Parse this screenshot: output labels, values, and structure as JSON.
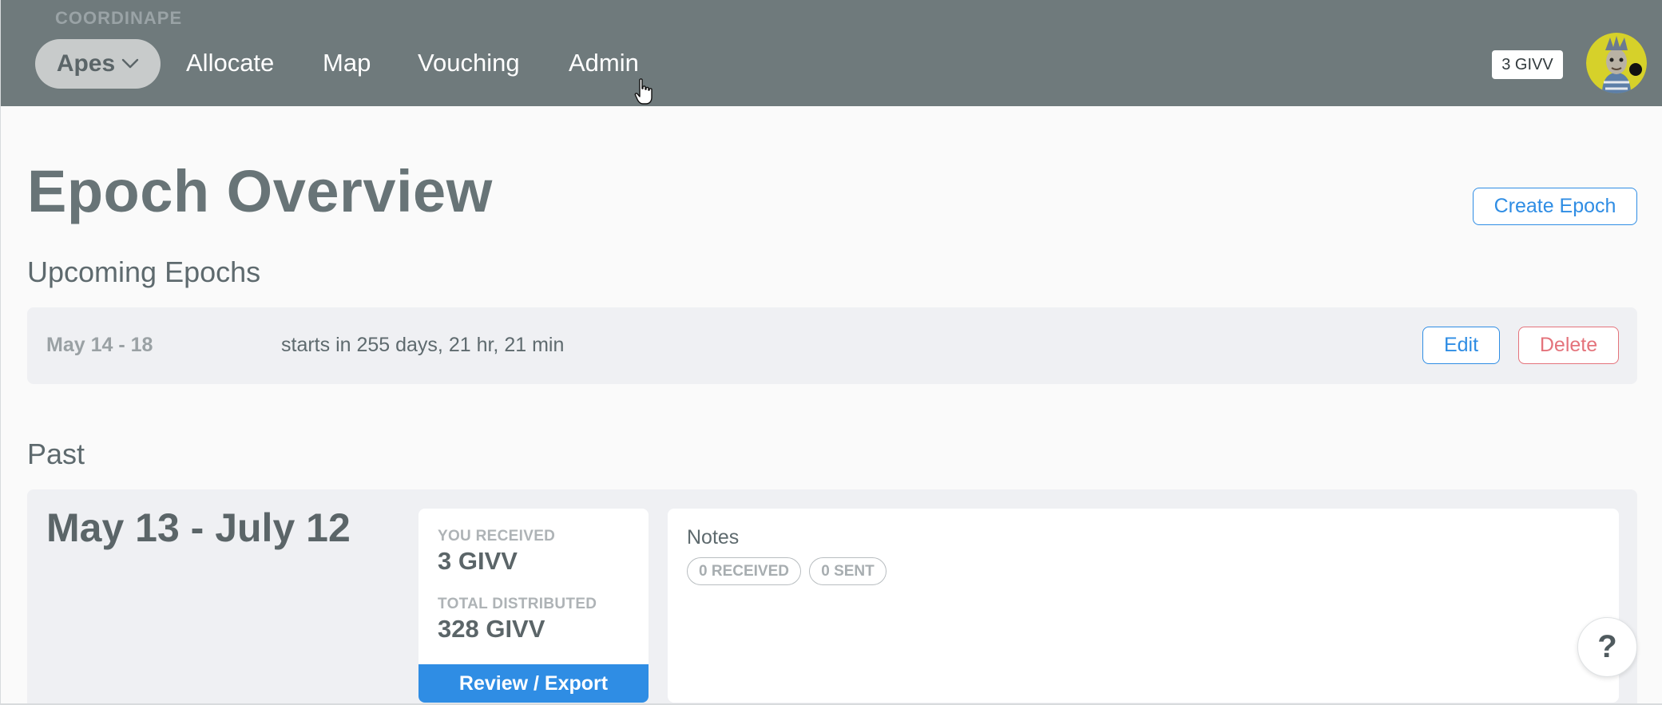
{
  "app": {
    "brand": "COORDINAPE"
  },
  "nav": {
    "circle_selector": "Apes",
    "links": [
      "Allocate",
      "Map",
      "Vouching",
      "Admin"
    ],
    "givv_badge": "3 GIVV"
  },
  "page": {
    "title": "Epoch Overview",
    "create_button": "Create Epoch"
  },
  "upcoming": {
    "heading": "Upcoming Epochs",
    "items": [
      {
        "dates": "May 14 - 18",
        "starts": "starts in 255 days, 21 hr, 21 min",
        "edit_label": "Edit",
        "delete_label": "Delete"
      }
    ]
  },
  "past": {
    "heading": "Past",
    "items": [
      {
        "dates": "May 13 - July 12",
        "received_label": "YOU RECEIVED",
        "received_value": "3 GIVV",
        "distributed_label": "TOTAL DISTRIBUTED",
        "distributed_value": "328 GIVV",
        "review_button": "Review / Export",
        "notes_title": "Notes",
        "notes_received": "0 RECEIVED",
        "notes_sent": "0 SENT"
      }
    ]
  },
  "help": {
    "label": "?"
  },
  "colors": {
    "topbar": "#6f7a7c",
    "accent_blue": "#2f8de4",
    "danger": "#e4737b",
    "panel": "#eff0f3"
  }
}
